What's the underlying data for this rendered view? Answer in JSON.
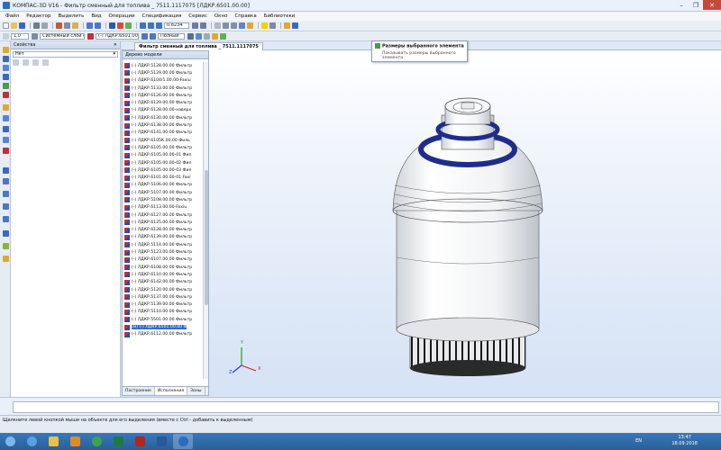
{
  "window": {
    "title": "КОМПАС-3D V16 - Фильтр сменный для топлива _ 7511.1117075 [ЛДКР.6501.00.00]",
    "min": "–",
    "max": "❐",
    "close": "✕"
  },
  "menu": [
    "Файл",
    "Редактор",
    "Выделить",
    "Вид",
    "Операции",
    "Спецификация",
    "Сервис",
    "Окно",
    "Справка",
    "Библиотеки"
  ],
  "toolbar": {
    "scale_value": "1.0",
    "layer_value": "Системный слой (0)",
    "part_value": "(-) ЛДКР.6501.00.00",
    "zoom_value": "0.8234",
    "mode_value": "Полный"
  },
  "properties_panel": {
    "title": "Свойства",
    "pin": "✕",
    "select_value": "Нет"
  },
  "model_tree": {
    "title": "Дерево модели",
    "items": [
      "(-) ЛДКР.5128.00.00 Фильтр",
      "(-) ЛДКР.5129.00.00 Фильтр",
      "(-) ЛДКР.6104/1.00.00-Faxiu",
      "(-) ЛДКР.5133.00.00 Фильтр",
      "(-) ЛДКР.6126.00.00 Фильтр",
      "(-) ЛДКР.6129.00.00 Фильтр",
      "(-) ЛДКР.6128.00.00-наверх",
      "(-) ЛДКР.6130.00.00 Фильтр",
      "(-) ЛДКР.6138.00.00 Фильтр",
      "(-) ЛДКР.6141.00.00 Фильтр",
      "(-) ЛДКР.6105К.00.00 Филь",
      "(-) ЛДКР.6105.00.00 Фильтр",
      "(-) ЛДКР.6105.00.00-01 Фил",
      "(-) ЛДКР.6105.00.00-02 Фил",
      "(-) ЛДКР.6105.00.00-03 Фил",
      "(-) ЛДКР.6101.00.00-01 Faxi",
      "(-) ЛДКР.5106.00.00 Фильтр",
      "(-) ЛДКР.5107.00.00 Фильтр",
      "(-) ЛДКР.5108.00.00 Фильтр",
      "(-) ЛДКР.6113.00.00-Faxiu",
      "(-) ЛДКР.6127.00.00 Фильтр",
      "(-) ЛДКР.6125.00.00 Фильтр",
      "(-) ЛДКР.6128.00.00 Фильтр",
      "(-) ЛДКР.6139.00.00 Фильтр",
      "(-) ЛДКР.5114.00.00 Фильтр",
      "(-) ЛДКР.5123.00.00 Фильтр",
      "(-) ЛДКР.6107.00.00 Фильтр",
      "(-) ЛДКР.6108.00.00 Фильтр",
      "(-) ЛДКР.6110.00.00 Фильтр",
      "(-) ЛДКР.6142.00.00 Фильтр",
      "(-) ЛДКР.5120.00.00 Фильтр",
      "(-) ЛДКР.5137.00.00 Фильтр",
      "(-) ЛДКР.5139.00.00 Фильтр",
      "(-) ЛДКР.5110.00.00 Фильтр",
      "(-) ЛДКР.5501.00.00 Фильтр",
      "(м) (-) ЛДКР.6501.00.00 Ф",
      "(-) ЛДКР.6112.00.00 Фильтр"
    ],
    "selected_index": 35,
    "tabs": [
      "Построение",
      "Исполнения",
      "Зоны"
    ]
  },
  "document_tab": {
    "label": "Фильтр сменный для топлива _ 7511.1117075"
  },
  "tooltip": {
    "title": "Размеры выбранного элемента",
    "description": "Показывать размеры выбранного элемента"
  },
  "axes": {
    "x": "X",
    "y": "Y",
    "z": "Z"
  },
  "status": {
    "text": "Щелкните левой кнопкой мыши на объекте для его выделения (вместе с Ctrl - добавить к выделенным)"
  },
  "taskbar": {
    "lang": "EN",
    "time": "13:47",
    "date": "18.09.2018"
  },
  "colors": {
    "ring": "#1e2d8c",
    "viewport_top": "#ffffff",
    "viewport_bottom": "#d6e3f5",
    "accent": "#2f6bd0"
  }
}
